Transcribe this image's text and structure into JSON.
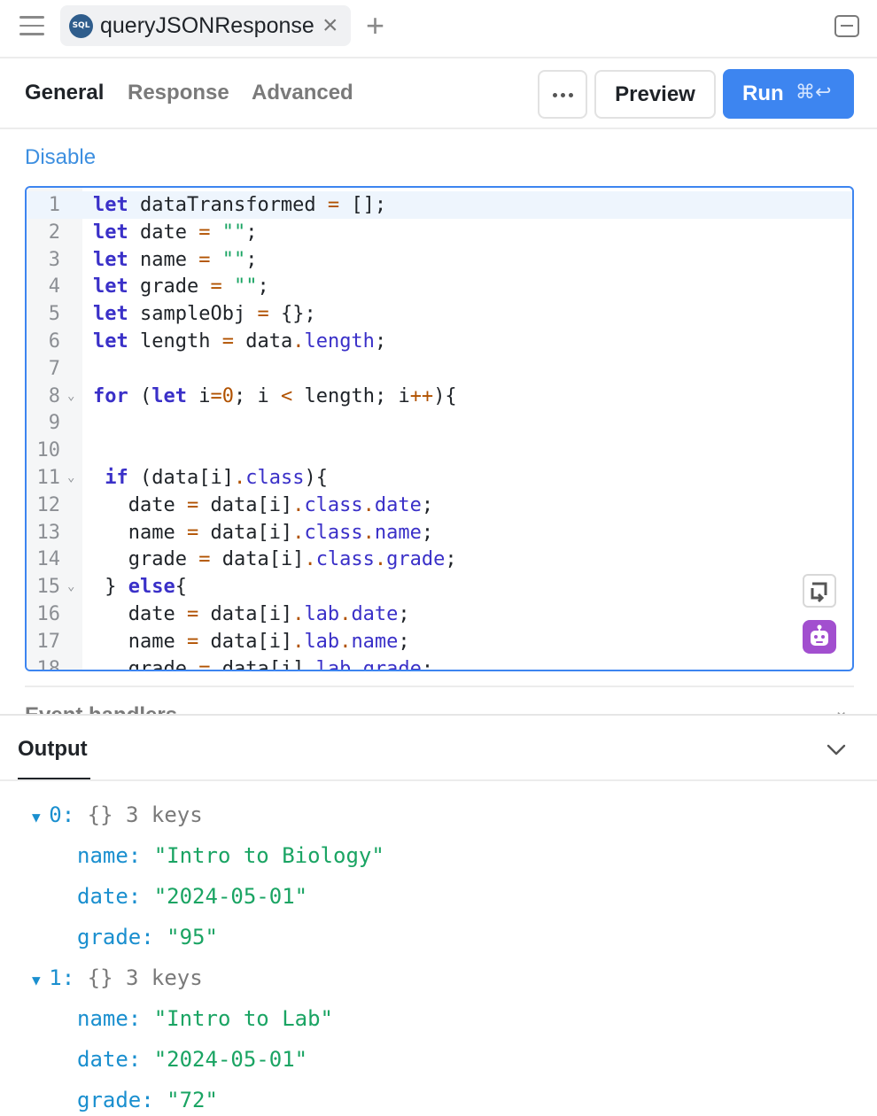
{
  "tab": {
    "badge": "SQL",
    "name": "queryJSONResponse"
  },
  "sections": [
    "General",
    "Response",
    "Advanced"
  ],
  "toolbar": {
    "preview": "Preview",
    "run": "Run",
    "run_shortcut": "⌘↩"
  },
  "disable_label": "Disable",
  "editor": {
    "line_numbers": [
      "1",
      "2",
      "3",
      "4",
      "5",
      "6",
      "7",
      "8",
      "9",
      "10",
      "11",
      "12",
      "13",
      "14",
      "15",
      "16",
      "17",
      "18"
    ],
    "lines": [
      "let dataTransformed = [];",
      "let date = \"\";",
      "let name = \"\";",
      "let grade = \"\";",
      "let sampleObj = {};",
      "let length = data.length;",
      "",
      "for (let i=0; i < length; i++){",
      "",
      "",
      " if (data[i].class){",
      "   date = data[i].class.date;",
      "   name = data[i].class.name;",
      "   grade = data[i].class.grade;",
      " } else{",
      "   date = data[i].lab.date;",
      "   name = data[i].lab.name;",
      "   grade = data[i].lab.grade;"
    ]
  },
  "event_handlers_label": "Event handlers",
  "output": {
    "title": "Output",
    "items": [
      {
        "index": "0:",
        "type": "{}",
        "count": "3 keys",
        "fields": [
          {
            "key": "name:",
            "value": "\"Intro to Biology\""
          },
          {
            "key": "date:",
            "value": "\"2024-05-01\""
          },
          {
            "key": "grade:",
            "value": "\"95\""
          }
        ]
      },
      {
        "index": "1:",
        "type": "{}",
        "count": "3 keys",
        "fields": [
          {
            "key": "name:",
            "value": "\"Intro to Lab\""
          },
          {
            "key": "date:",
            "value": "\"2024-05-01\""
          },
          {
            "key": "grade:",
            "value": "\"72\""
          }
        ]
      }
    ]
  },
  "colors": {
    "accent": "#3d85f0",
    "keyword": "#3a30c8",
    "string": "#1aa463",
    "operator": "#b15200",
    "json_key": "#1a8fcf"
  }
}
